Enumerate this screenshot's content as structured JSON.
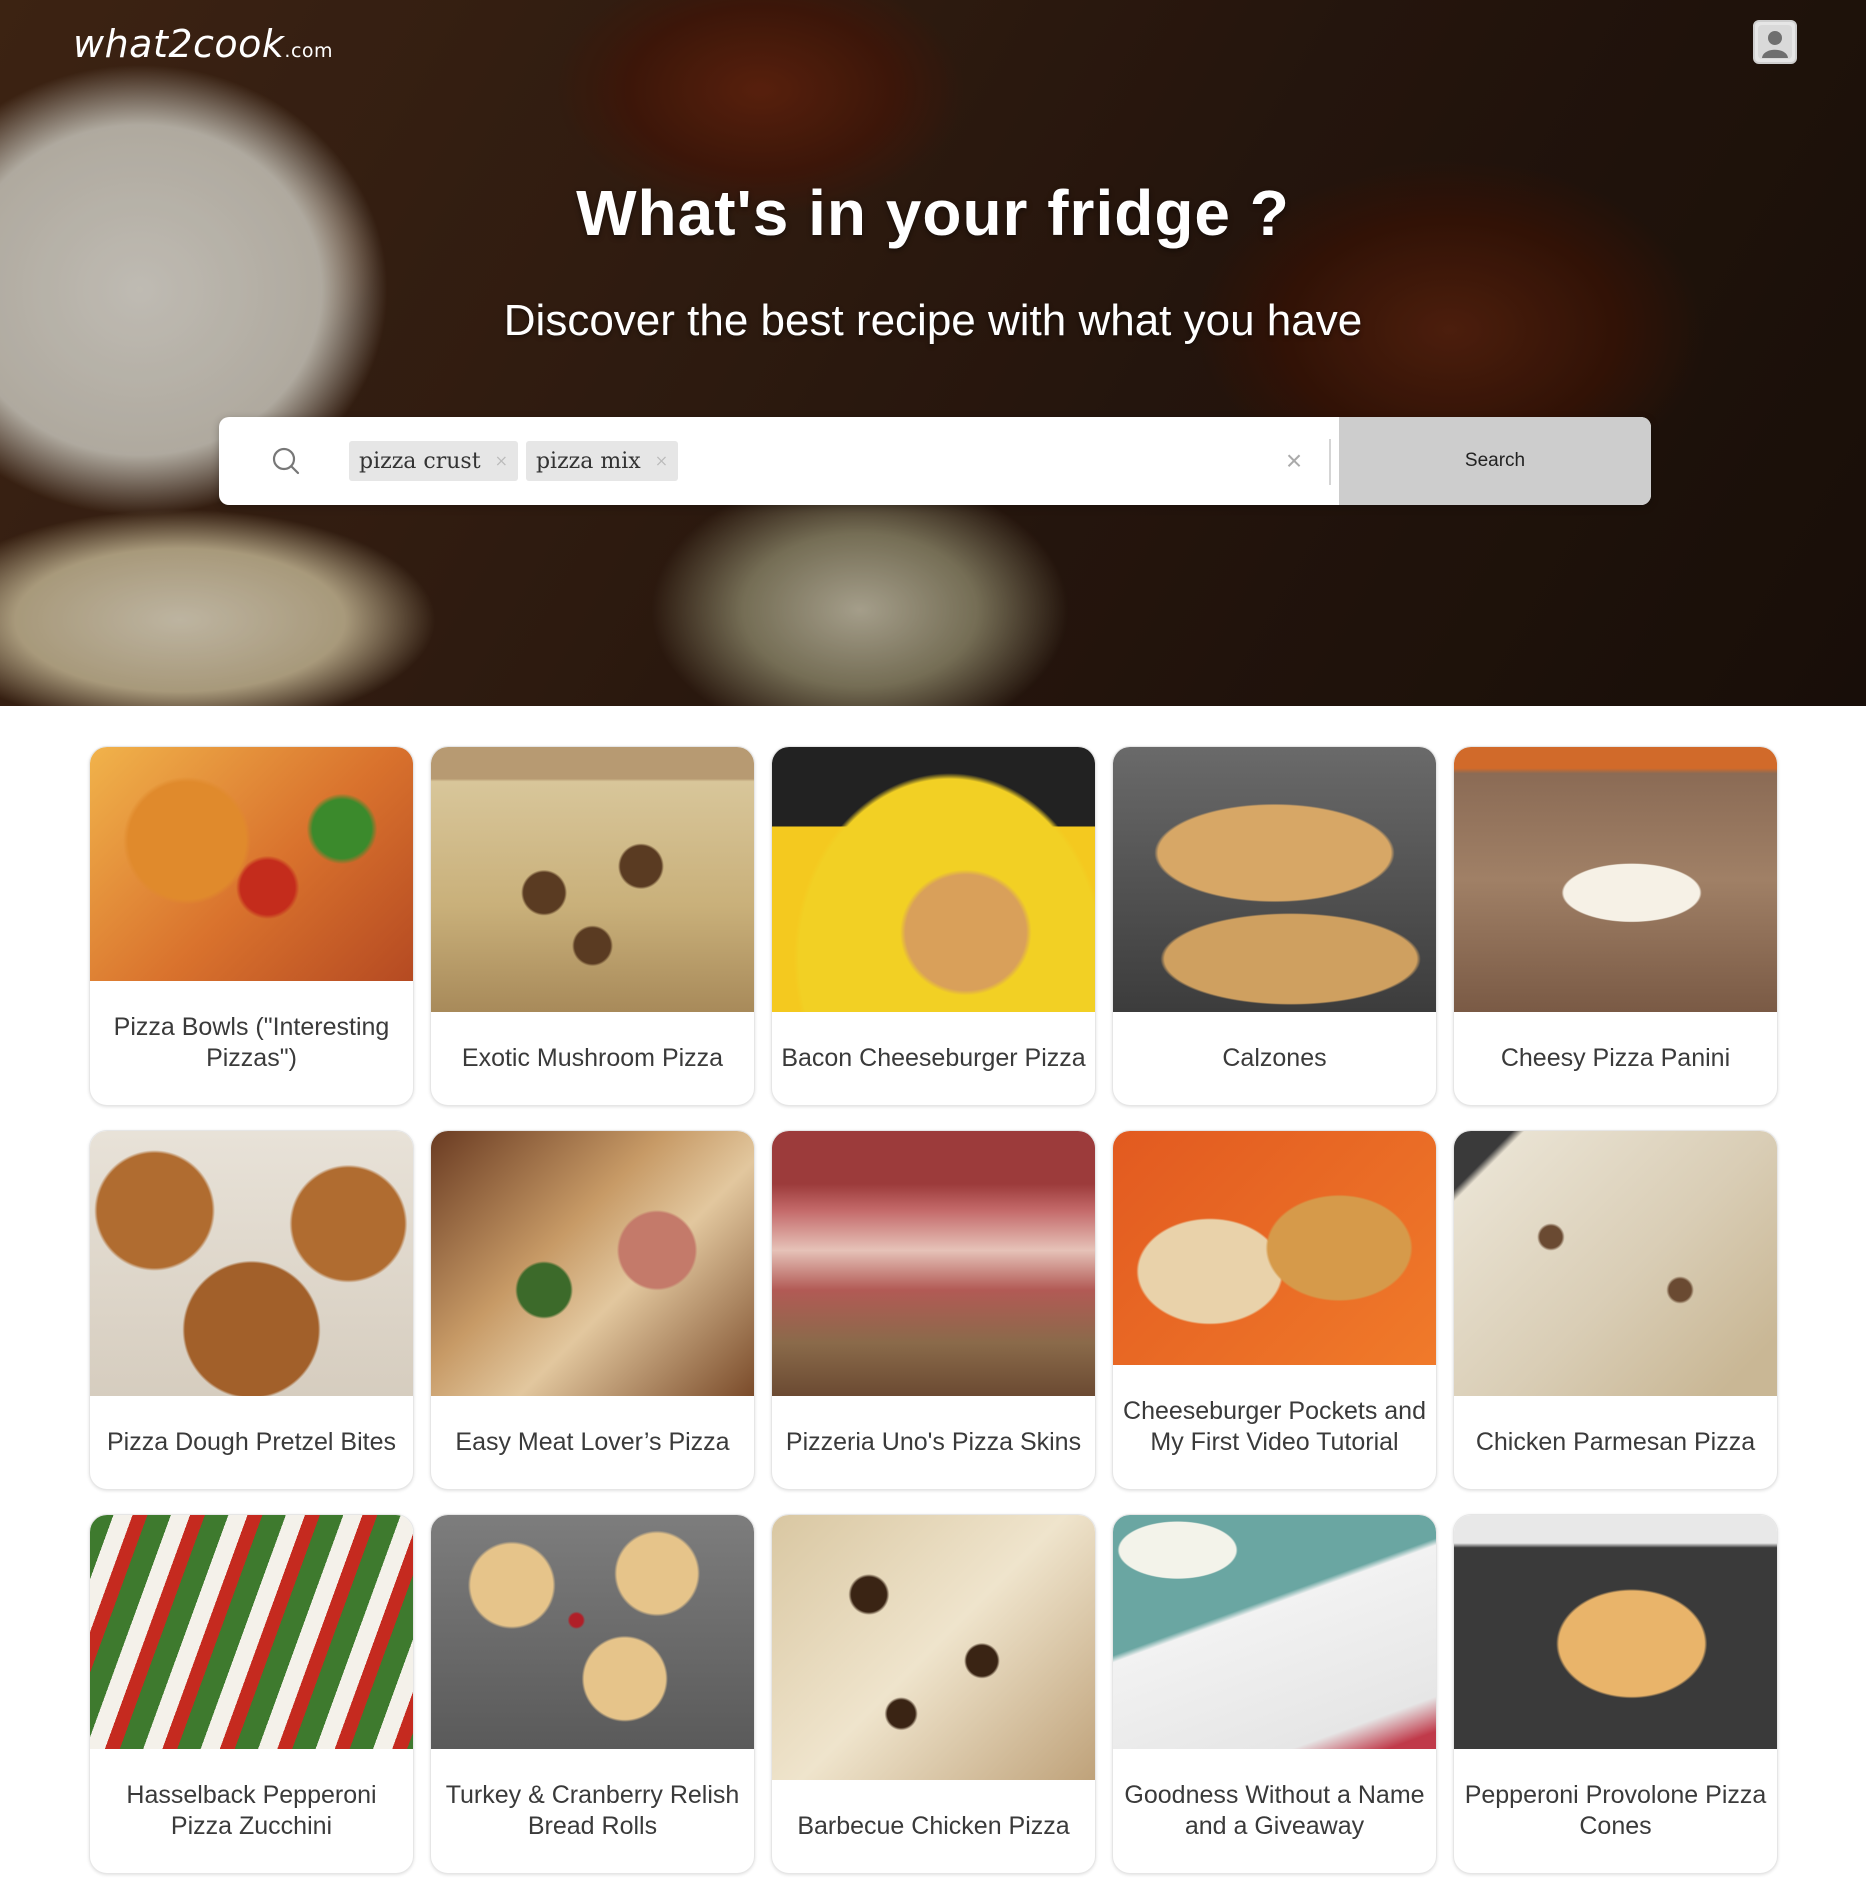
{
  "header": {
    "brand": "what2cook",
    "brand_suffix": ".com",
    "user_icon": "user-avatar-icon"
  },
  "hero": {
    "title": "What's in your fridge ?",
    "subtitle": "Discover the best recipe with what you have"
  },
  "search": {
    "icon": "search-icon",
    "chips": [
      {
        "label": "pizza crust",
        "remove": "×"
      },
      {
        "label": "pizza mix",
        "remove": "×"
      }
    ],
    "clear_label": "×",
    "button_label": "Search"
  },
  "recipes": [
    {
      "title": "Pizza Bowls (\"Interesting Pizzas\")"
    },
    {
      "title": "Exotic Mushroom Pizza"
    },
    {
      "title": "Bacon Cheeseburger Pizza"
    },
    {
      "title": "Calzones"
    },
    {
      "title": "Cheesy Pizza Panini"
    },
    {
      "title": "Pizza Dough Pretzel Bites"
    },
    {
      "title": "Easy Meat Lover’s Pizza"
    },
    {
      "title": "Pizzeria Uno's Pizza Skins"
    },
    {
      "title": "Cheeseburger Pockets and My First Video Tutorial"
    },
    {
      "title": "Chicken Parmesan Pizza"
    },
    {
      "title": "Hasselback Pepperoni Pizza Zucchini"
    },
    {
      "title": "Turkey & Cranberry Relish Bread Rolls"
    },
    {
      "title": "Barbecue Chicken Pizza"
    },
    {
      "title": "Goodness Without a Name and a Giveaway"
    },
    {
      "title": "Pepperoni Provolone Pizza Cones"
    }
  ]
}
